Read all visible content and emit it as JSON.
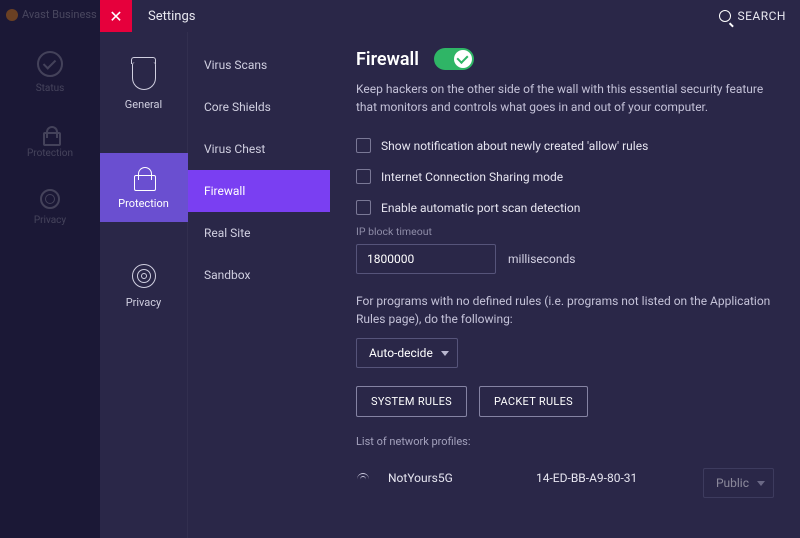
{
  "app_name": "Avast Business",
  "far_left": {
    "items": [
      {
        "label": "Status"
      },
      {
        "label": "Protection"
      },
      {
        "label": "Privacy"
      }
    ]
  },
  "modal": {
    "title": "Settings",
    "search_label": "SEARCH"
  },
  "categories": [
    {
      "label": "General"
    },
    {
      "label": "Protection"
    },
    {
      "label": "Privacy"
    }
  ],
  "subnav": [
    {
      "label": "Virus Scans"
    },
    {
      "label": "Core Shields"
    },
    {
      "label": "Virus Chest"
    },
    {
      "label": "Firewall"
    },
    {
      "label": "Real Site"
    },
    {
      "label": "Sandbox"
    }
  ],
  "firewall": {
    "heading": "Firewall",
    "toggle_on": true,
    "description": "Keep hackers on the other side of the wall with this essential security feature that monitors and controls what goes in and out of your computer.",
    "cb_show_notification": "Show notification about newly created 'allow' rules",
    "cb_ics_mode": "Internet Connection Sharing mode",
    "cb_port_scan": "Enable automatic port scan detection",
    "ip_block_label": "IP block timeout",
    "ip_block_value": "1800000",
    "ip_block_unit": "milliseconds",
    "undefined_rules_text": "For programs with no defined rules (i.e. programs not listed on the Application Rules page), do the following:",
    "undefined_rules_select": "Auto-decide",
    "btn_system_rules": "SYSTEM RULES",
    "btn_packet_rules": "PACKET RULES",
    "profiles_label": "List of network profiles:",
    "profiles": [
      {
        "name": "NotYours5G",
        "mac": "14-ED-BB-A9-80-31",
        "type": "Public"
      }
    ]
  }
}
